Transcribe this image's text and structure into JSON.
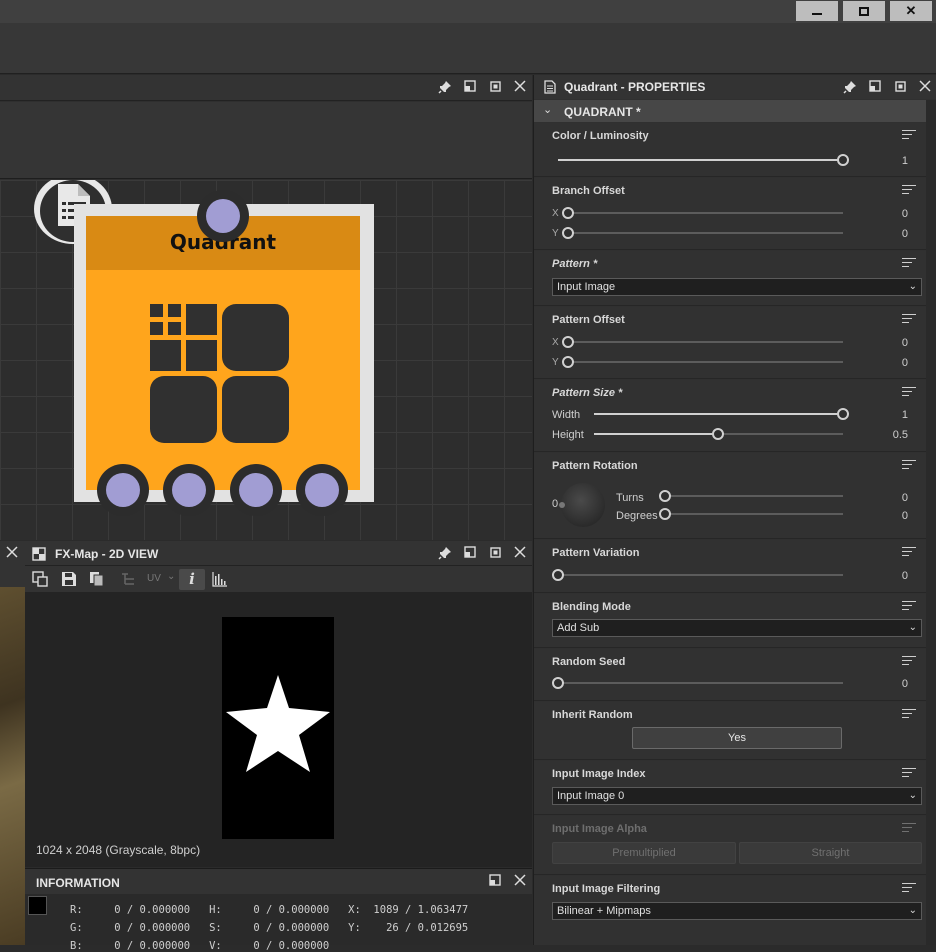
{
  "window": {
    "minimize_icon": "minimize-icon",
    "restore_icon": "restore-icon",
    "close_label": "✕"
  },
  "graph": {
    "node": {
      "title": "Quadrant",
      "icon": "quadrant-icon",
      "badge_icon": "document-list-icon",
      "port_color": "#a19dd3",
      "header_color": "#d98a14",
      "body_color": "#ffa51c"
    }
  },
  "view2d": {
    "title": "FX-Map - 2D VIEW",
    "toolbar": {
      "uv_label": "UV",
      "info_label": "i"
    },
    "image_info": "1024 x 2048 (Grayscale, 8bpc)"
  },
  "information": {
    "title": "INFORMATION",
    "rows": [
      "R:     0 / 0.000000   H:     0 / 0.000000   X:  1089 / 1.063477",
      "G:     0 / 0.000000   S:     0 / 0.000000   Y:    26 / 0.012695",
      "B:     0 / 0.000000   V:     0 / 0.000000"
    ]
  },
  "properties": {
    "title": "Quadrant - PROPERTIES",
    "section": "QUADRANT *",
    "color_luminosity": {
      "label": "Color / Luminosity",
      "value": "1",
      "fraction": 1.0
    },
    "branch_offset": {
      "label": "Branch Offset",
      "x_label": "X",
      "y_label": "Y",
      "x": "0",
      "y": "0"
    },
    "pattern": {
      "label": "Pattern *",
      "value": "Input Image"
    },
    "pattern_offset": {
      "label": "Pattern  Offset",
      "x_label": "X",
      "y_label": "Y",
      "x": "0",
      "y": "0"
    },
    "pattern_size": {
      "label": "Pattern Size *",
      "width_label": "Width",
      "height_label": "Height",
      "width": "1",
      "height": "0.5",
      "width_fraction": 1.0,
      "height_fraction": 0.5
    },
    "pattern_rotation": {
      "label": "Pattern Rotation",
      "dial_value": "0",
      "turns_label": "Turns",
      "degrees_label": "Degrees",
      "turns": "0",
      "degrees": "0"
    },
    "pattern_variation": {
      "label": "Pattern Variation",
      "value": "0"
    },
    "blending_mode": {
      "label": "Blending Mode",
      "value": "Add Sub"
    },
    "random_seed": {
      "label": "Random Seed",
      "value": "0"
    },
    "inherit_random": {
      "label": "Inherit Random",
      "value": "Yes"
    },
    "input_image_index": {
      "label": "Input Image Index",
      "value": "Input Image 0"
    },
    "input_image_alpha": {
      "label": "Input Image Alpha",
      "opt1": "Premultiplied",
      "opt2": "Straight"
    },
    "input_image_filtering": {
      "label": "Input Image Filtering",
      "value": "Bilinear + Mipmaps"
    }
  }
}
